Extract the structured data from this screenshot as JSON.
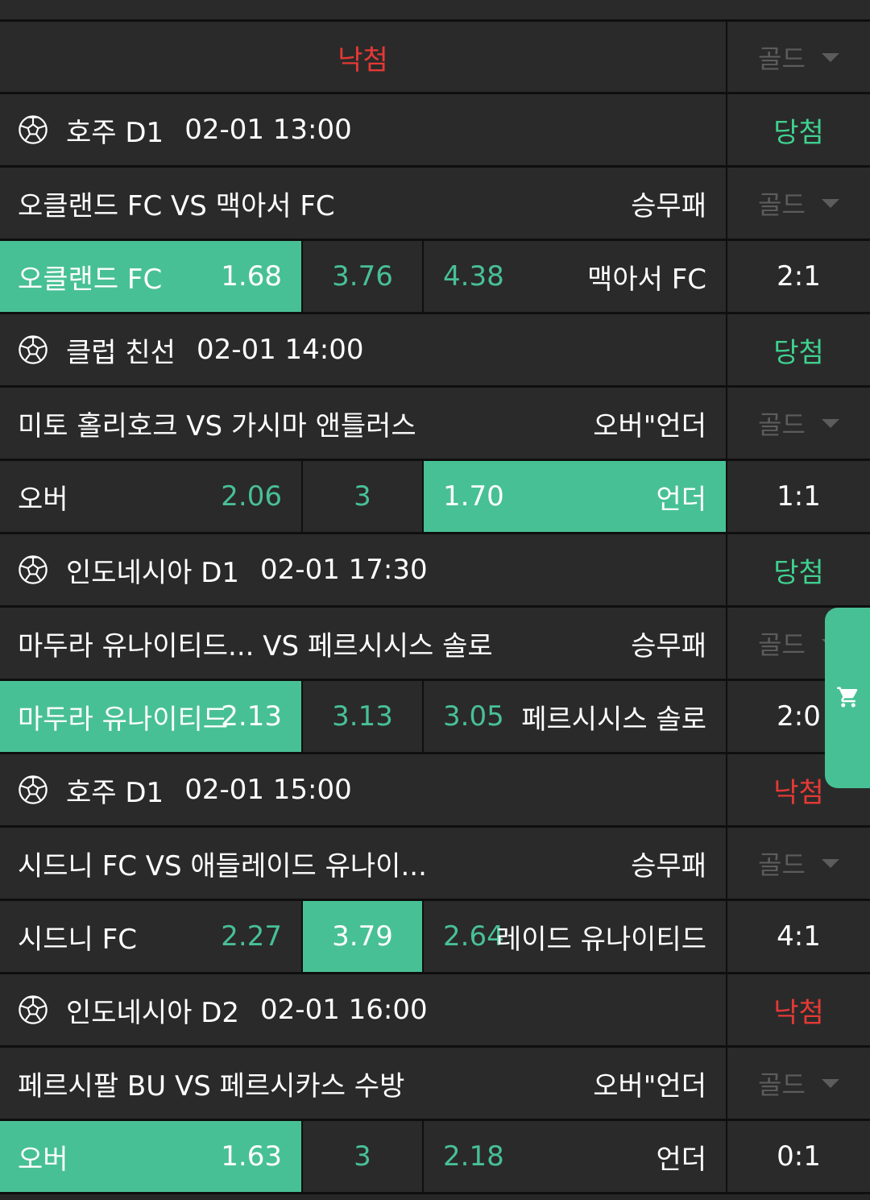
{
  "header": {
    "status": "낙첨",
    "gold_label": "골드"
  },
  "games": [
    {
      "league": "호주 D1",
      "datetime": "02-01 13:00",
      "result": "당첨",
      "match": "오클랜드 FC VS 맥아서 FC",
      "market": "승무패",
      "gold_label": "골드",
      "home_label": "오클랜드 FC",
      "home_odd": "1.68",
      "mid": "3.76",
      "away_odd": "4.38",
      "away_label": "맥아서 FC",
      "score": "2:1",
      "selected": "home"
    },
    {
      "league": "클럽 친선",
      "datetime": "02-01 14:00",
      "result": "당첨",
      "match": "미토 홀리호크 VS 가시마 앤틀러스",
      "market": "오버\"언더",
      "gold_label": "골드",
      "home_label": "오버",
      "home_odd": "2.06",
      "mid": "3",
      "away_odd": "1.70",
      "away_label": "언더",
      "score": "1:1",
      "selected": "away"
    },
    {
      "league": "인도네시아 D1",
      "datetime": "02-01 17:30",
      "result": "당첨",
      "match": "마두라 유나이티드... VS 페르시시스 솔로",
      "market": "승무패",
      "gold_label": "골드",
      "home_label": "마두라 유나이티드",
      "home_odd": "2.13",
      "mid": "3.13",
      "away_odd": "3.05",
      "away_label": "페르시시스 솔로",
      "score": "2:0",
      "selected": "home"
    },
    {
      "league": "호주 D1",
      "datetime": "02-01 15:00",
      "result": "낙첨",
      "match": "시드니 FC VS 애들레이드 유나이...",
      "market": "승무패",
      "gold_label": "골드",
      "home_label": "시드니 FC",
      "home_odd": "2.27",
      "mid": "3.79",
      "away_odd": "2.64",
      "away_label": "레이드 유나이티드",
      "score": "4:1",
      "selected": "mid"
    },
    {
      "league": "인도네시아 D2",
      "datetime": "02-01 16:00",
      "result": "낙첨",
      "match": "페르시팔 BU VS 페르시카스 수방",
      "market": "오버\"언더",
      "gold_label": "골드",
      "home_label": "오버",
      "home_odd": "1.63",
      "mid": "3",
      "away_odd": "2.18",
      "away_label": "언더",
      "score": "0:1",
      "selected": "home"
    }
  ],
  "colors": {
    "accent": "#48c096",
    "win": "#3fd08f",
    "lose": "#e53935",
    "bg": "#2a2a2a",
    "divider": "#0f0f0f"
  },
  "icons": {
    "league": "soccer-ball-icon",
    "dropdown": "chevron-down-icon",
    "cart": "cart-icon"
  }
}
